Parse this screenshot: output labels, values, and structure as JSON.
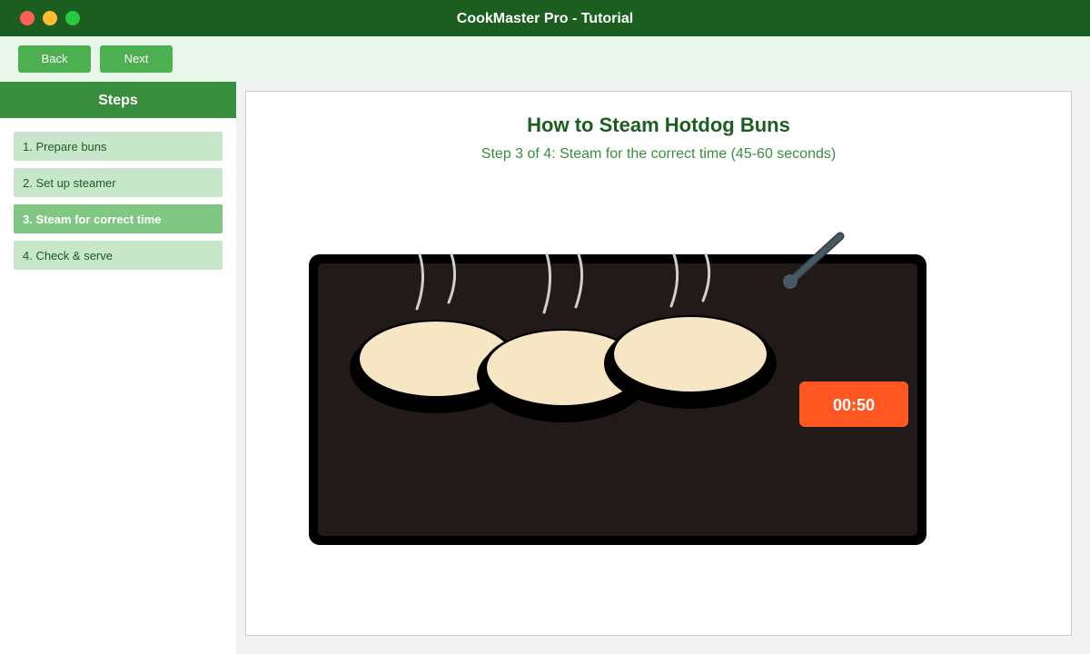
{
  "window": {
    "title": "CookMaster Pro - Tutorial"
  },
  "toolbar": {
    "back_label": "Back",
    "next_label": "Next"
  },
  "sidebar": {
    "header": "Steps",
    "items": [
      {
        "label": "1. Prepare buns",
        "active": false
      },
      {
        "label": "2. Set up steamer",
        "active": false
      },
      {
        "label": "3. Steam for correct time",
        "active": true
      },
      {
        "label": "4. Check & serve",
        "active": false
      }
    ]
  },
  "main": {
    "title": "How to Steam Hotdog Buns",
    "subtitle": "Step 3 of 4: Steam for the correct time (45-60 seconds)",
    "timer": "00:50"
  },
  "colors": {
    "title_bar": "#1b5e20",
    "accent": "#4caf50",
    "active_step": "#81c784",
    "steamer": "#221a18",
    "bun": "#f6e6c4",
    "timer": "#ff5722",
    "thermometer": "#455a64"
  },
  "icons": {
    "thermometer": "thermometer-icon",
    "steam": "steam-icon"
  }
}
